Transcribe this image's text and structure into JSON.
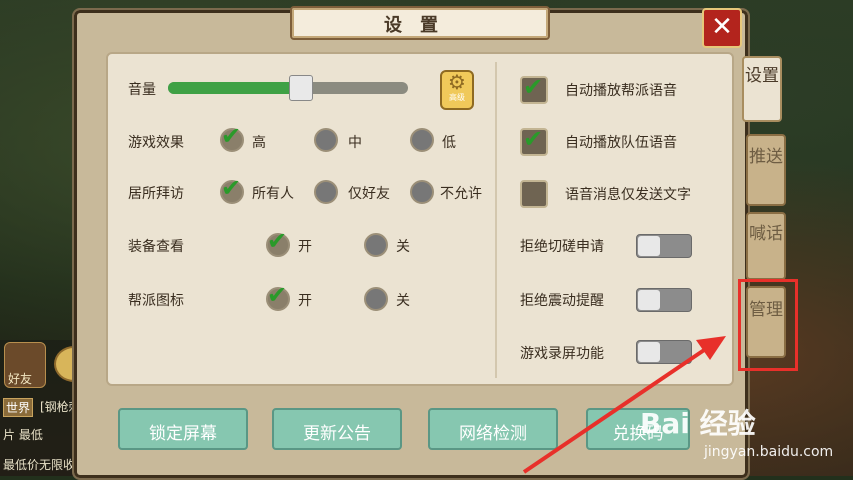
{
  "dialog": {
    "title": "设置",
    "close_label": "✕"
  },
  "tabs": [
    {
      "label": "设置"
    },
    {
      "label": "推送"
    },
    {
      "label": "喊话"
    },
    {
      "label": "管理"
    }
  ],
  "volume": {
    "label": "音量",
    "level": 0.55,
    "advanced_label": "高级"
  },
  "effects": {
    "label": "游戏效果",
    "options": [
      "高",
      "中",
      "低"
    ],
    "selected": "高"
  },
  "residence": {
    "label": "居所拜访",
    "options": [
      "所有人",
      "仅好友",
      "不允许"
    ],
    "selected": "所有人"
  },
  "equipment": {
    "label": "装备查看",
    "options": [
      "开",
      "关"
    ],
    "selected": "开"
  },
  "guild_icon": {
    "label": "帮派图标",
    "options": [
      "开",
      "关"
    ],
    "selected": "开"
  },
  "voice": [
    {
      "label": "自动播放帮派语音",
      "checked": true
    },
    {
      "label": "自动播放队伍语音",
      "checked": true
    },
    {
      "label": "语音消息仅发送文字",
      "checked": false
    }
  ],
  "toggles": [
    {
      "label": "拒绝切磋申请",
      "on": false
    },
    {
      "label": "拒绝震动提醒",
      "on": false
    },
    {
      "label": "游戏录屏功能",
      "on": false
    }
  ],
  "buttons": [
    "锁定屏幕",
    "更新公告",
    "网络检测",
    "兑换码"
  ],
  "background": {
    "friend_label": "好友",
    "chat_tag": "世界",
    "chat_lines": [
      "[钢枪刺",
      "片 最低",
      "最低价无限收"
    ]
  },
  "watermark": {
    "brand": "Bai 经验",
    "url": "jingyan.baidu.com"
  },
  "colors": {
    "accent_green": "#3fa145",
    "close_red": "#b3241d",
    "highlight_red": "#e8302a"
  }
}
